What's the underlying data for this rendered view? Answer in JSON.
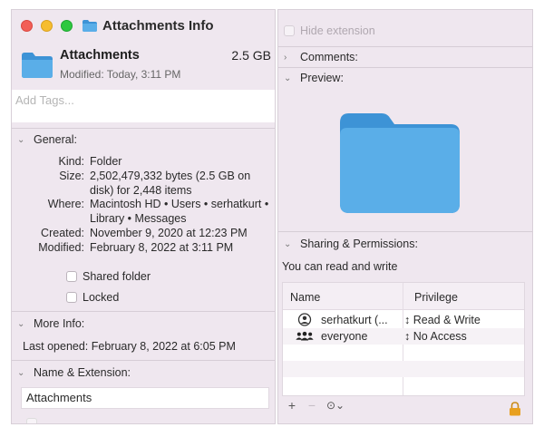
{
  "window": {
    "title": "Attachments Info"
  },
  "header": {
    "name": "Attachments",
    "size": "2.5 GB",
    "modified": "Modified: Today, 3:11 PM"
  },
  "tags": {
    "placeholder": "Add Tags..."
  },
  "general": {
    "heading": "General:",
    "rows": [
      {
        "key": "Kind:",
        "value": "Folder"
      },
      {
        "key": "Size:",
        "value": "2,502,479,332 bytes (2.5 GB on disk) for 2,448 items"
      },
      {
        "key": "Where:",
        "value": "Macintosh HD • Users • serhatkurt • Library • Messages"
      },
      {
        "key": "Created:",
        "value": "November 9, 2020 at 12:23 PM"
      },
      {
        "key": "Modified:",
        "value": "February 8, 2022 at 3:11 PM"
      }
    ],
    "shared_folder": "Shared folder",
    "locked": "Locked"
  },
  "more_info": {
    "heading": "More Info:",
    "last_opened": "Last opened: February 8, 2022 at 6:05 PM"
  },
  "name_extension": {
    "heading": "Name & Extension:",
    "name_value": "Attachments",
    "hide_extension": "Hide extension"
  },
  "comments": {
    "heading": "Comments:"
  },
  "preview": {
    "heading": "Preview:"
  },
  "sharing": {
    "heading": "Sharing & Permissions:",
    "status": "You can read and write",
    "columns": [
      "Name",
      "Privilege"
    ],
    "rows": [
      {
        "name": "serhatkurt (...",
        "privilege": "↕ Read & Write",
        "icon": "user-icon"
      },
      {
        "name": "everyone",
        "privilege": "↕ No Access",
        "icon": "group-icon"
      }
    ],
    "add": "+",
    "remove": "−",
    "action": "⊙⌄"
  },
  "colors": {
    "panel": "#efe7ef",
    "folder": "#5aaee8",
    "folder_tab": "#3d93d6",
    "lock": "#e8a020"
  }
}
